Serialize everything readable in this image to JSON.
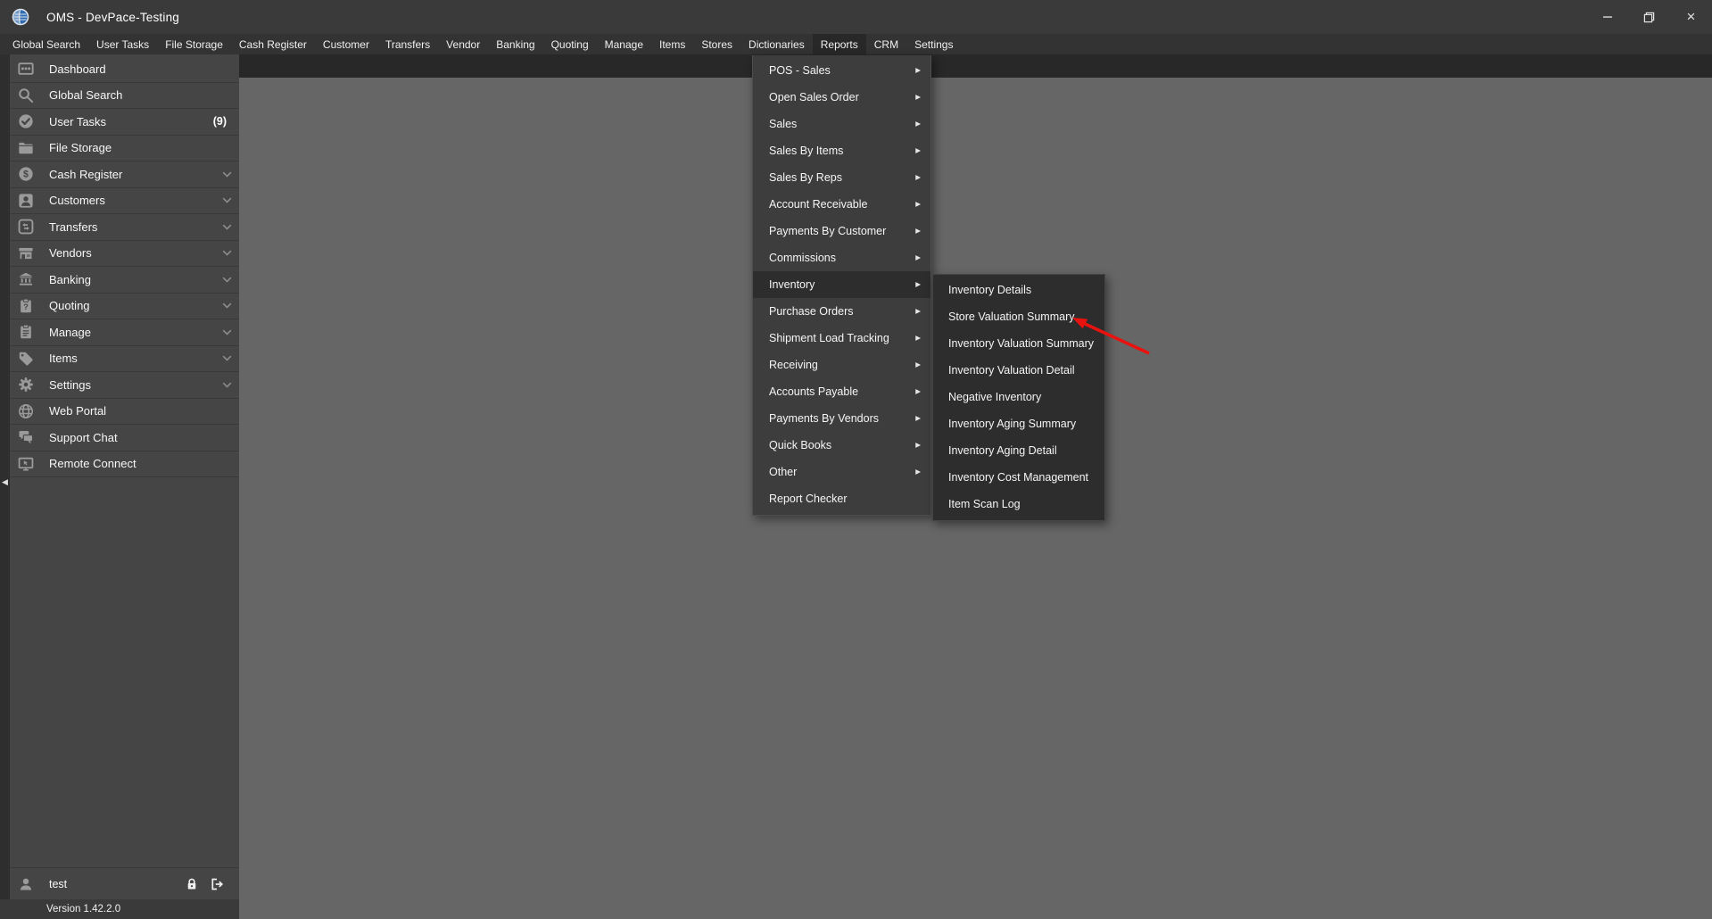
{
  "window": {
    "title": "OMS - DevPace-Testing",
    "controls": [
      "minimize",
      "restore",
      "close"
    ]
  },
  "menubar": {
    "items": [
      {
        "label": "Global Search"
      },
      {
        "label": "User Tasks"
      },
      {
        "label": "File Storage"
      },
      {
        "label": "Cash Register"
      },
      {
        "label": "Customer"
      },
      {
        "label": "Transfers"
      },
      {
        "label": "Vendor"
      },
      {
        "label": "Banking"
      },
      {
        "label": "Quoting"
      },
      {
        "label": "Manage"
      },
      {
        "label": "Items"
      },
      {
        "label": "Stores"
      },
      {
        "label": "Dictionaries"
      },
      {
        "label": "Reports",
        "active": true
      },
      {
        "label": "CRM"
      },
      {
        "label": "Settings"
      }
    ]
  },
  "sidebar": {
    "items": [
      {
        "label": "Dashboard",
        "icon": "dashboard-icon"
      },
      {
        "label": "Global Search",
        "icon": "search-icon"
      },
      {
        "label": "User Tasks",
        "icon": "check-circle-icon",
        "badge": "(9)"
      },
      {
        "label": "File Storage",
        "icon": "folder-icon"
      },
      {
        "label": "Cash Register",
        "icon": "dollar-circle-icon",
        "expandable": true
      },
      {
        "label": "Customers",
        "icon": "person-card-icon",
        "expandable": true
      },
      {
        "label": "Transfers",
        "icon": "cycle-icon",
        "expandable": true
      },
      {
        "label": "Vendors",
        "icon": "storefront-icon",
        "expandable": true
      },
      {
        "label": "Banking",
        "icon": "bank-icon",
        "expandable": true
      },
      {
        "label": "Quoting",
        "icon": "clipboard-question-icon",
        "expandable": true
      },
      {
        "label": "Manage",
        "icon": "clipboard-lines-icon",
        "expandable": true
      },
      {
        "label": "Items",
        "icon": "tag-icon",
        "expandable": true
      },
      {
        "label": "Settings",
        "icon": "gear-icon",
        "expandable": true
      },
      {
        "label": "Web Portal",
        "icon": "globe-icon"
      },
      {
        "label": "Support Chat",
        "icon": "chat-icon"
      },
      {
        "label": "Remote Connect",
        "icon": "remote-desktop-icon"
      }
    ],
    "user": {
      "name": "test"
    },
    "version": "Version 1.42.2.0"
  },
  "reports_menu": {
    "items": [
      {
        "label": "POS - Sales",
        "has_submenu": true
      },
      {
        "label": "Open Sales Order",
        "has_submenu": true
      },
      {
        "label": "Sales",
        "has_submenu": true
      },
      {
        "label": "Sales By Items",
        "has_submenu": true
      },
      {
        "label": "Sales By Reps",
        "has_submenu": true
      },
      {
        "label": "Account Receivable",
        "has_submenu": true
      },
      {
        "label": "Payments By Customer",
        "has_submenu": true
      },
      {
        "label": "Commissions",
        "has_submenu": true
      },
      {
        "label": "Inventory",
        "has_submenu": true,
        "highlighted": true
      },
      {
        "label": "Purchase Orders",
        "has_submenu": true
      },
      {
        "label": "Shipment Load Tracking",
        "has_submenu": true
      },
      {
        "label": "Receiving",
        "has_submenu": true
      },
      {
        "label": "Accounts Payable",
        "has_submenu": true
      },
      {
        "label": "Payments By Vendors",
        "has_submenu": true
      },
      {
        "label": "Quick Books",
        "has_submenu": true
      },
      {
        "label": "Other",
        "has_submenu": true
      },
      {
        "label": "Report Checker",
        "has_submenu": false
      }
    ]
  },
  "inventory_submenu": {
    "items": [
      "Inventory Details",
      "Store Valuation Summary",
      "Inventory Valuation Summary",
      "Inventory Valuation Detail",
      "Negative Inventory",
      "Inventory Aging Summary",
      "Inventory Aging Detail",
      "Inventory Cost Management",
      "Item Scan Log"
    ]
  },
  "annotation": {
    "type": "arrow",
    "color": "#e8120f",
    "points_at": "Store Valuation Summary"
  },
  "colors": {
    "titlebar": "#3a3a3a",
    "menubar": "#333333",
    "active_menu": "#282828",
    "content": "#666666",
    "sidebar": "#454545",
    "dropdown_panel": "#3d3d3d",
    "submenu_panel": "#2d2d2d",
    "arrow": "#e8120f"
  }
}
